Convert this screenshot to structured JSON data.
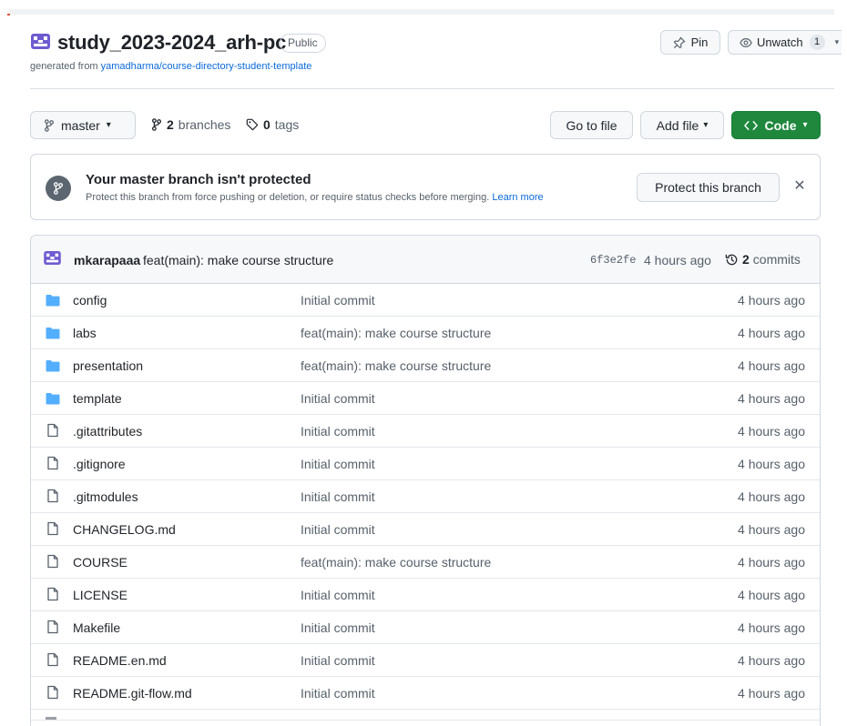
{
  "repo": {
    "name": "study_2023-2024_arh-pc",
    "visibility": "Public",
    "generated_prefix": "generated from ",
    "template_link": "yamadharma/course-directory-student-template"
  },
  "actions": {
    "pin_label": "Pin",
    "unwatch_label": "Unwatch",
    "watch_count": "1"
  },
  "nav": {
    "branch": "master",
    "branches_count": "2",
    "branches_label": "branches",
    "tags_count": "0",
    "tags_label": "tags",
    "go_to_file": "Go to file",
    "add_file": "Add file",
    "code": "Code"
  },
  "banner": {
    "title": "Your master branch isn't protected",
    "description": "Protect this branch from force pushing or deletion, or require status checks before merging.",
    "learn_more": "Learn more",
    "protect_button": "Protect this branch"
  },
  "latest_commit": {
    "author": "mkarapaaa",
    "message": "feat(main): make course structure",
    "sha": "6f3e2fe",
    "time": "4 hours ago",
    "commits_count": "2",
    "commits_label": "commits"
  },
  "files": [
    {
      "type": "dir",
      "name": "config",
      "message": "Initial commit",
      "time": "4 hours ago"
    },
    {
      "type": "dir",
      "name": "labs",
      "message": "feat(main): make course structure",
      "time": "4 hours ago"
    },
    {
      "type": "dir",
      "name": "presentation",
      "message": "feat(main): make course structure",
      "time": "4 hours ago"
    },
    {
      "type": "dir",
      "name": "template",
      "message": "Initial commit",
      "time": "4 hours ago"
    },
    {
      "type": "file",
      "name": ".gitattributes",
      "message": "Initial commit",
      "time": "4 hours ago"
    },
    {
      "type": "file",
      "name": ".gitignore",
      "message": "Initial commit",
      "time": "4 hours ago"
    },
    {
      "type": "file",
      "name": ".gitmodules",
      "message": "Initial commit",
      "time": "4 hours ago"
    },
    {
      "type": "file",
      "name": "CHANGELOG.md",
      "message": "Initial commit",
      "time": "4 hours ago"
    },
    {
      "type": "file",
      "name": "COURSE",
      "message": "feat(main): make course structure",
      "time": "4 hours ago"
    },
    {
      "type": "file",
      "name": "LICENSE",
      "message": "Initial commit",
      "time": "4 hours ago"
    },
    {
      "type": "file",
      "name": "Makefile",
      "message": "Initial commit",
      "time": "4 hours ago"
    },
    {
      "type": "file",
      "name": "README.en.md",
      "message": "Initial commit",
      "time": "4 hours ago"
    },
    {
      "type": "file",
      "name": "README.git-flow.md",
      "message": "Initial commit",
      "time": "4 hours ago"
    }
  ],
  "colors": {
    "link": "#0969da",
    "folder": "#54aeff",
    "primary_button": "#1f883d",
    "avatar": "#6e5bd1"
  },
  "icons": {
    "avatar": "identicon-avatar-icon",
    "pin": "pin-icon",
    "eye": "eye-icon",
    "branch": "git-branch-icon",
    "tag": "tag-icon",
    "code": "code-icon",
    "history": "history-icon",
    "folder": "folder-icon",
    "file": "file-icon",
    "close": "x-icon"
  }
}
